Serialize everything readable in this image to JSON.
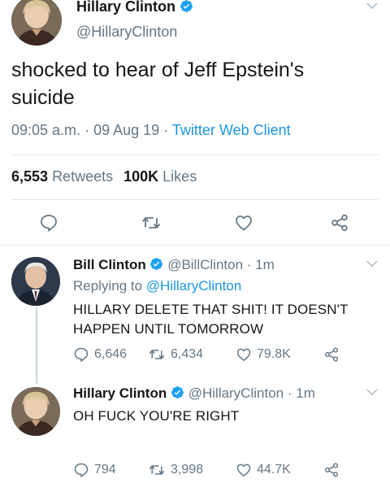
{
  "main_tweet": {
    "author_name": "Hillary Clinton",
    "handle": "@HillaryClinton",
    "text": "shocked to hear of Jeff Epstein's suicide",
    "time": "09:05 a.m.",
    "sep1": "·",
    "date": "09 Aug 19",
    "sep2": "·",
    "client": "Twitter Web Client",
    "retweets_count": "6,553",
    "retweets_label": "Retweets",
    "likes_count": "100K",
    "likes_label": "Likes"
  },
  "reply1": {
    "author_name": "Bill Clinton",
    "handle": "@BillClinton",
    "sep": "·",
    "age": "1m",
    "replying_label": "Replying to",
    "replying_handle": "@HillaryClinton",
    "text": "HILLARY DELETE THAT SHIT! IT DOESN'T HAPPEN UNTIL TOMORROW",
    "replies": "6,646",
    "retweets": "6,434",
    "likes": "79.8K"
  },
  "reply2": {
    "author_name": "Hillary Clinton",
    "handle": "@HillaryClinton",
    "sep": "·",
    "age": "1m",
    "text": "OH FUCK YOU'RE RIGHT",
    "replies": "794",
    "retweets": "3,998",
    "likes": "44.7K"
  },
  "colors": {
    "link_blue": "#1b95e0",
    "muted_gray": "#657786",
    "divider": "#e1e8ed",
    "verified_blue": "#1da1f2"
  },
  "icons": [
    "verified-badge-icon",
    "chevron-down-icon",
    "reply-icon",
    "retweet-icon",
    "like-icon",
    "share-icon",
    "avatar-hillary",
    "avatar-bill"
  ]
}
